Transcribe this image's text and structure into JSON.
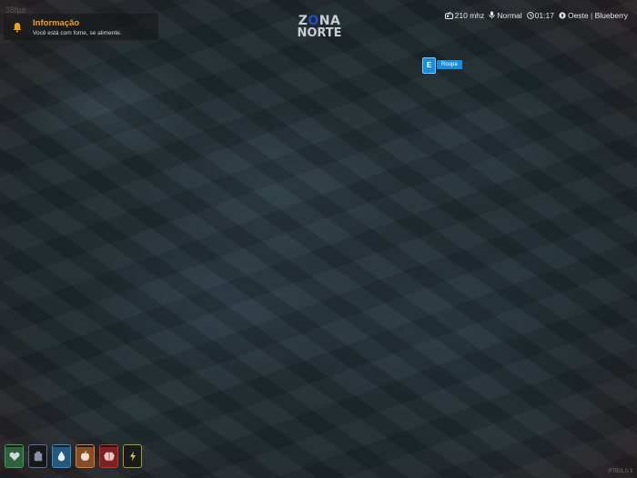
{
  "corner_label": "38fps",
  "notification": {
    "title": "Informação",
    "message": "Você está com fome, se alimente.",
    "icon": "bell-icon"
  },
  "logo": {
    "line1_a": "Z",
    "line1_o": "O",
    "line1_b": "NA",
    "line2": "NORTE"
  },
  "hud": {
    "radio": "210 mhz",
    "voice": "Normal",
    "time": "01:17",
    "direction": "Oeste",
    "street": "Blueberry"
  },
  "interaction": {
    "key": "E",
    "label": "Roupa"
  },
  "status": [
    {
      "name": "health",
      "icon": "heart-icon",
      "level": 0.9,
      "color": "#3f9c5a"
    },
    {
      "name": "armor",
      "icon": "armor-icon",
      "level": 0.0,
      "color": "#5a6a9a"
    },
    {
      "name": "thirst",
      "icon": "water-drop-icon",
      "level": 0.9,
      "color": "#2f90d0"
    },
    {
      "name": "hunger",
      "icon": "food-icon",
      "level": 0.9,
      "color": "#e07a30"
    },
    {
      "name": "stress",
      "icon": "brain-icon",
      "level": 0.9,
      "color": "#d02a2a"
    },
    {
      "name": "stamina",
      "icon": "lightning-icon",
      "level": 0.0,
      "color": "#9aa030"
    }
  ],
  "version": "PTB/1.0.3"
}
